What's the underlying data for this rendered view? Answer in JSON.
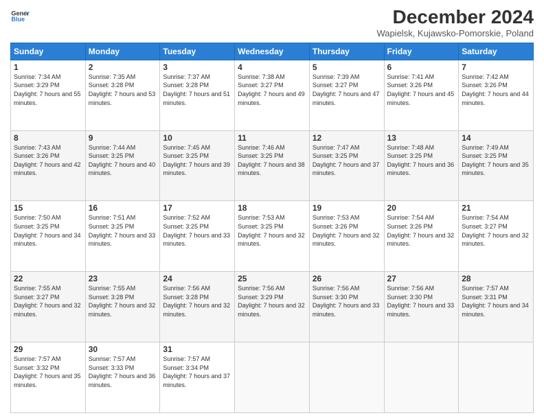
{
  "header": {
    "logo_line1": "General",
    "logo_line2": "Blue",
    "month": "December 2024",
    "location": "Wapielsk, Kujawsko-Pomorskie, Poland"
  },
  "days_of_week": [
    "Sunday",
    "Monday",
    "Tuesday",
    "Wednesday",
    "Thursday",
    "Friday",
    "Saturday"
  ],
  "weeks": [
    [
      {
        "day": 1,
        "sunrise": "7:34 AM",
        "sunset": "3:29 PM",
        "daylight": "7 hours and 55 minutes."
      },
      {
        "day": 2,
        "sunrise": "7:35 AM",
        "sunset": "3:28 PM",
        "daylight": "7 hours and 53 minutes."
      },
      {
        "day": 3,
        "sunrise": "7:37 AM",
        "sunset": "3:28 PM",
        "daylight": "7 hours and 51 minutes."
      },
      {
        "day": 4,
        "sunrise": "7:38 AM",
        "sunset": "3:27 PM",
        "daylight": "7 hours and 49 minutes."
      },
      {
        "day": 5,
        "sunrise": "7:39 AM",
        "sunset": "3:27 PM",
        "daylight": "7 hours and 47 minutes."
      },
      {
        "day": 6,
        "sunrise": "7:41 AM",
        "sunset": "3:26 PM",
        "daylight": "7 hours and 45 minutes."
      },
      {
        "day": 7,
        "sunrise": "7:42 AM",
        "sunset": "3:26 PM",
        "daylight": "7 hours and 44 minutes."
      }
    ],
    [
      {
        "day": 8,
        "sunrise": "7:43 AM",
        "sunset": "3:26 PM",
        "daylight": "7 hours and 42 minutes."
      },
      {
        "day": 9,
        "sunrise": "7:44 AM",
        "sunset": "3:25 PM",
        "daylight": "7 hours and 40 minutes."
      },
      {
        "day": 10,
        "sunrise": "7:45 AM",
        "sunset": "3:25 PM",
        "daylight": "7 hours and 39 minutes."
      },
      {
        "day": 11,
        "sunrise": "7:46 AM",
        "sunset": "3:25 PM",
        "daylight": "7 hours and 38 minutes."
      },
      {
        "day": 12,
        "sunrise": "7:47 AM",
        "sunset": "3:25 PM",
        "daylight": "7 hours and 37 minutes."
      },
      {
        "day": 13,
        "sunrise": "7:48 AM",
        "sunset": "3:25 PM",
        "daylight": "7 hours and 36 minutes."
      },
      {
        "day": 14,
        "sunrise": "7:49 AM",
        "sunset": "3:25 PM",
        "daylight": "7 hours and 35 minutes."
      }
    ],
    [
      {
        "day": 15,
        "sunrise": "7:50 AM",
        "sunset": "3:25 PM",
        "daylight": "7 hours and 34 minutes."
      },
      {
        "day": 16,
        "sunrise": "7:51 AM",
        "sunset": "3:25 PM",
        "daylight": "7 hours and 33 minutes."
      },
      {
        "day": 17,
        "sunrise": "7:52 AM",
        "sunset": "3:25 PM",
        "daylight": "7 hours and 33 minutes."
      },
      {
        "day": 18,
        "sunrise": "7:53 AM",
        "sunset": "3:25 PM",
        "daylight": "7 hours and 32 minutes."
      },
      {
        "day": 19,
        "sunrise": "7:53 AM",
        "sunset": "3:26 PM",
        "daylight": "7 hours and 32 minutes."
      },
      {
        "day": 20,
        "sunrise": "7:54 AM",
        "sunset": "3:26 PM",
        "daylight": "7 hours and 32 minutes."
      },
      {
        "day": 21,
        "sunrise": "7:54 AM",
        "sunset": "3:27 PM",
        "daylight": "7 hours and 32 minutes."
      }
    ],
    [
      {
        "day": 22,
        "sunrise": "7:55 AM",
        "sunset": "3:27 PM",
        "daylight": "7 hours and 32 minutes."
      },
      {
        "day": 23,
        "sunrise": "7:55 AM",
        "sunset": "3:28 PM",
        "daylight": "7 hours and 32 minutes."
      },
      {
        "day": 24,
        "sunrise": "7:56 AM",
        "sunset": "3:28 PM",
        "daylight": "7 hours and 32 minutes."
      },
      {
        "day": 25,
        "sunrise": "7:56 AM",
        "sunset": "3:29 PM",
        "daylight": "7 hours and 32 minutes."
      },
      {
        "day": 26,
        "sunrise": "7:56 AM",
        "sunset": "3:30 PM",
        "daylight": "7 hours and 33 minutes."
      },
      {
        "day": 27,
        "sunrise": "7:56 AM",
        "sunset": "3:30 PM",
        "daylight": "7 hours and 33 minutes."
      },
      {
        "day": 28,
        "sunrise": "7:57 AM",
        "sunset": "3:31 PM",
        "daylight": "7 hours and 34 minutes."
      }
    ],
    [
      {
        "day": 29,
        "sunrise": "7:57 AM",
        "sunset": "3:32 PM",
        "daylight": "7 hours and 35 minutes."
      },
      {
        "day": 30,
        "sunrise": "7:57 AM",
        "sunset": "3:33 PM",
        "daylight": "7 hours and 36 minutes."
      },
      {
        "day": 31,
        "sunrise": "7:57 AM",
        "sunset": "3:34 PM",
        "daylight": "7 hours and 37 minutes."
      },
      null,
      null,
      null,
      null
    ]
  ]
}
